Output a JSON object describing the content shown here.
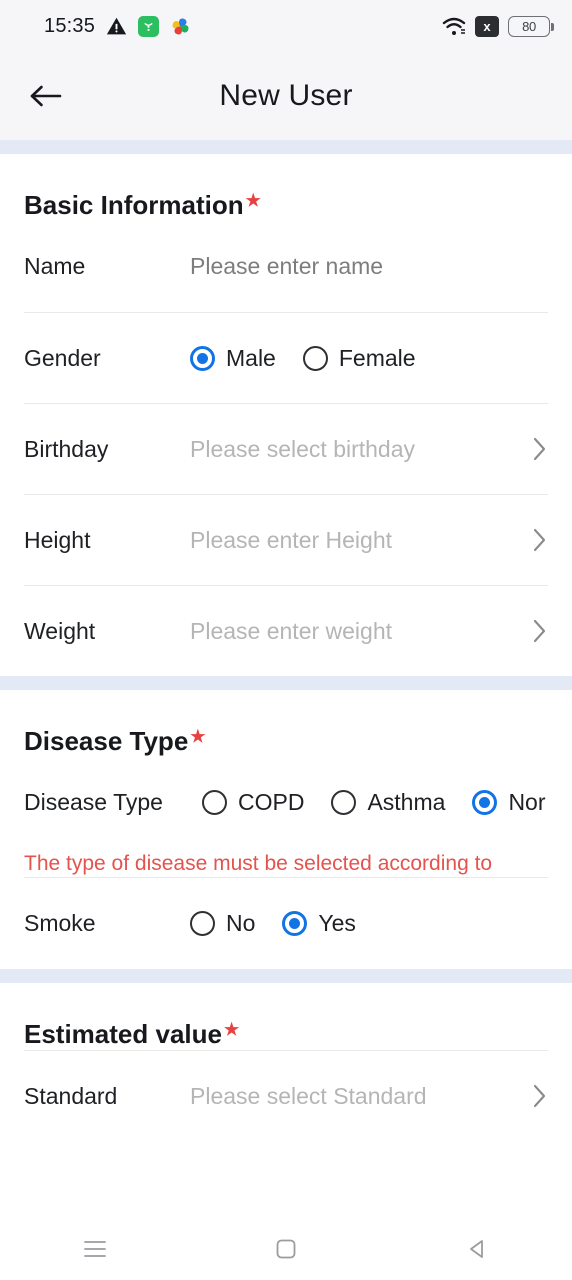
{
  "status_bar": {
    "time": "15:35",
    "battery_level": "80",
    "x_badge_label": "x",
    "icons": [
      "warning-triangle-icon",
      "green-app-icon",
      "colorful-app-icon",
      "wifi-icon",
      "x-badge-icon",
      "battery-icon"
    ]
  },
  "app_bar": {
    "title": "New User",
    "back_icon": "arrow-left-icon"
  },
  "colors": {
    "accent_blue": "#1274e4",
    "required_star_red": "#e64242",
    "error_red": "#e3544f",
    "band_blue_grey": "#e4eaf5",
    "header_bg": "#f6f6f8",
    "placeholder_grey": "#b5b5b5",
    "label_dark": "#1e2024"
  },
  "sections": [
    {
      "title": "Basic Information",
      "required": "★",
      "rows": [
        {
          "label": "Name",
          "placeholder": "Please enter name",
          "type": "input",
          "value_style": "dark",
          "chevron": false
        },
        {
          "label": "Gender",
          "type": "radio",
          "chevron": false,
          "options": [
            {
              "text": "Male",
              "selected": true
            },
            {
              "text": "Female",
              "selected": false
            }
          ]
        },
        {
          "label": "Birthday",
          "placeholder": "Please select birthday",
          "type": "picker",
          "chevron": true
        },
        {
          "label": "Height",
          "placeholder": "Please enter Height",
          "type": "picker",
          "chevron": true
        },
        {
          "label": "Weight",
          "placeholder": "Please enter weight",
          "type": "picker",
          "chevron": true
        }
      ]
    },
    {
      "title": "Disease Type",
      "required": "★",
      "error_message": "The type of disease must be selected according to personal information",
      "rows": [
        {
          "label": "Disease Type",
          "type": "radio",
          "overflow": true,
          "options": [
            {
              "text": "COPD",
              "selected": false
            },
            {
              "text": "Asthma",
              "selected": false
            },
            {
              "text": "Nor",
              "selected": true
            }
          ]
        },
        {
          "label": "Smoke",
          "type": "radio",
          "options": [
            {
              "text": "No",
              "selected": false
            },
            {
              "text": "Yes",
              "selected": true
            }
          ]
        }
      ]
    },
    {
      "title": "Estimated value",
      "required": "★",
      "rows": [
        {
          "label": "Standard",
          "placeholder": "Please select Standard",
          "type": "picker",
          "chevron": true
        }
      ]
    }
  ],
  "nav_bar": {
    "items": [
      {
        "name": "recents-button",
        "icon": "menu-lines-icon"
      },
      {
        "name": "home-button",
        "icon": "square-icon"
      },
      {
        "name": "back-button",
        "icon": "triangle-left-icon"
      }
    ]
  }
}
